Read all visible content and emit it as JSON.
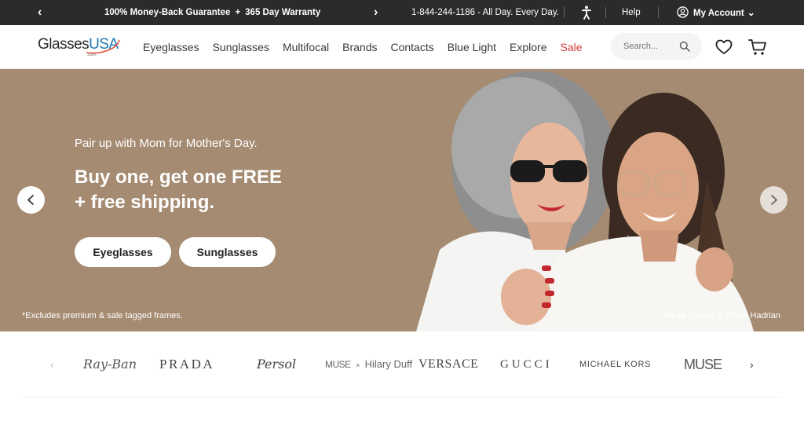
{
  "topbar": {
    "guarantee": "100% Money-Back Guarantee",
    "plus": "+",
    "warranty": "365 Day Warranty",
    "phone": "1-844-244-1186 - All Day. Every Day.",
    "help": "Help",
    "account": "My Account"
  },
  "logo": {
    "glasses": "Glasses",
    "usa": "USA",
    "com": ".com"
  },
  "nav": {
    "items": [
      "Eyeglasses",
      "Sunglasses",
      "Multifocal",
      "Brands",
      "Contacts",
      "Blue Light",
      "Explore"
    ],
    "sale": "Sale"
  },
  "search": {
    "placeholder": "Search..."
  },
  "hero": {
    "subtitle": "Pair up with Mom for Mother's Day.",
    "headline_line1": "Buy one, get one FREE",
    "headline_line2": "+ free shipping.",
    "button_eyeglasses": "Eyeglasses",
    "button_sunglasses": "Sunglasses",
    "footnote": "*Excludes premium & sale tagged frames.",
    "credit": "Muse Optical & Photo Hadrian"
  },
  "brands": {
    "rayban": "Ray-Ban",
    "prada": "PRADA",
    "persol": "Persol",
    "muse_hd_muse": "MUSE",
    "muse_hd_x": "×",
    "muse_hd_name": "Hilary Duff",
    "versace": "VERSACE",
    "gucci": "GUCCI",
    "michael_kors": "MICHAEL KORS",
    "muse": "MUSE"
  },
  "colors": {
    "topbar_bg": "#2b2b2b",
    "brand_blue": "#1f78b9",
    "sale_red": "#d63a3a",
    "hero_bg": "#a58b72"
  },
  "icons": [
    "chevron-left-icon",
    "chevron-right-icon",
    "accessibility-icon",
    "user-icon",
    "chevron-down-icon",
    "search-icon",
    "heart-icon",
    "cart-icon"
  ]
}
